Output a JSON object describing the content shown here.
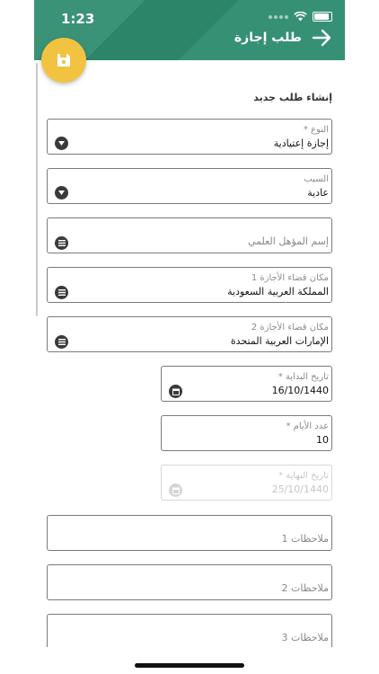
{
  "status_bar": {
    "time": "1:23"
  },
  "header": {
    "title": "طلب إجازة"
  },
  "form": {
    "section_title": "إنشاء طلب جديد",
    "type": {
      "label": "النوع *",
      "value": "إجازة إعتيادية"
    },
    "reason": {
      "label": "السبب",
      "value": "عادية"
    },
    "qualification": {
      "placeholder": "إسم المؤهل العلمي"
    },
    "place1": {
      "label": "مكان قضاء الأجازة 1",
      "value": "المملكة العربية السعودية"
    },
    "place2": {
      "label": "مكان قضاء الأجازة 2",
      "value": "الإمارات العربية المتحدة"
    },
    "start_date": {
      "label": "تاريخ البداية *",
      "value": "16/10/1440"
    },
    "days": {
      "label": "عدد الأيام *",
      "value": "10"
    },
    "end_date": {
      "label": "تاريخ النهاية *",
      "value": "25/10/1440"
    },
    "notes1": {
      "placeholder": "ملاحظات 1"
    },
    "notes2": {
      "placeholder": "ملاحظات 2"
    },
    "notes3": {
      "placeholder": "ملاحظات 3"
    }
  },
  "colors": {
    "header": "#2e8b6f",
    "fab": "#f2c341"
  }
}
